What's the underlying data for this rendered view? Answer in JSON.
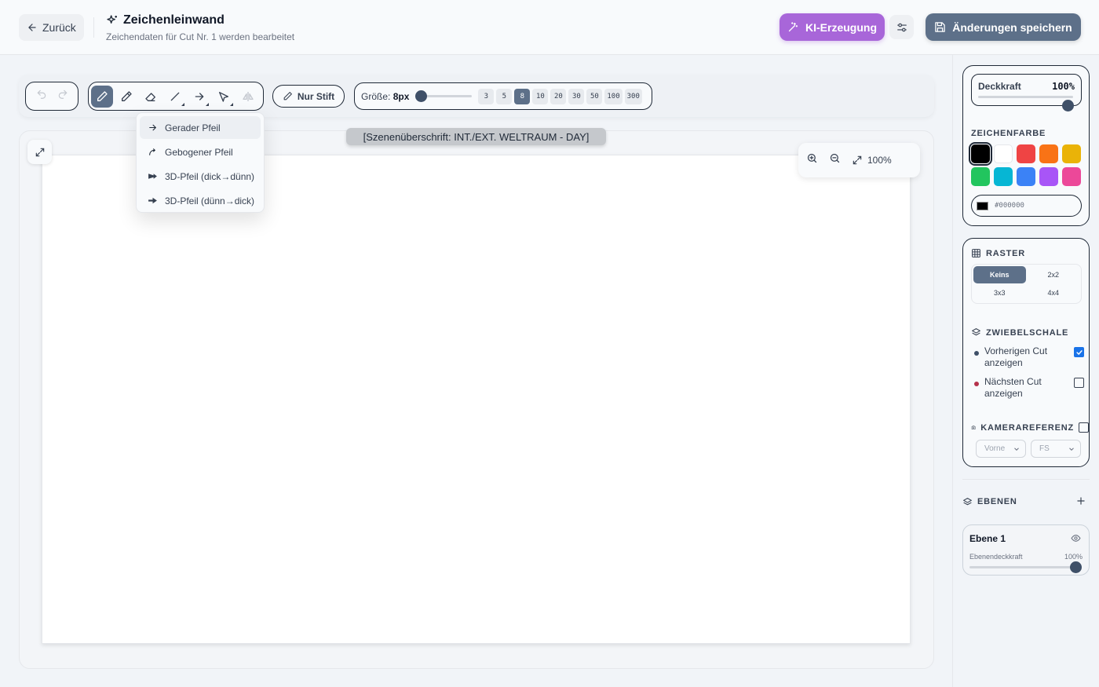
{
  "header": {
    "back_label": "Zurück",
    "title": "Zeichenleinwand",
    "subtitle": "Zeichendaten für Cut Nr. 1 werden bearbeitet",
    "ai_label": "KI-Erzeugung",
    "save_label": "Änderungen speichern"
  },
  "toolbar": {
    "pen_only_label": "Nur Stift",
    "size_label": "Größe:",
    "size_value": "8px",
    "size_presets": [
      "3",
      "5",
      "8",
      "10",
      "20",
      "30",
      "50",
      "100",
      "300"
    ],
    "active_preset": "8"
  },
  "arrow_menu": {
    "items": [
      {
        "label": "Gerader Pfeil",
        "icon": "arrow-right-icon"
      },
      {
        "label": "Gebogener Pfeil",
        "icon": "curved-arrow-icon"
      },
      {
        "label": "3D-Pfeil (dick→dünn)",
        "icon": "3d-arrow-thick-thin-icon"
      },
      {
        "label": "3D-Pfeil (dünn→dick)",
        "icon": "3d-arrow-thin-thick-icon"
      }
    ]
  },
  "canvas": {
    "scene_heading": "[Szenenüberschrift: INT./EXT. WELTRAUM - DAY]",
    "zoom": "100%"
  },
  "sidebar": {
    "opacity_label": "Deckkraft",
    "opacity_value": "100%",
    "color_title": "ZEICHENFARBE",
    "colors": [
      "#000000",
      "#ffffff",
      "#ef4444",
      "#f97316",
      "#eab308",
      "#22c55e",
      "#06b6d4",
      "#3b82f6",
      "#a855f7",
      "#ec4899"
    ],
    "selected_color": "#000000",
    "grid_title": "RASTER",
    "grid_options": [
      "Keins",
      "2x2",
      "3x3",
      "4x4"
    ],
    "grid_active": "Keins",
    "onion_title": "ZWIEBELSCHALE",
    "onion_prev": "Vorherigen Cut anzeigen",
    "onion_next": "Nächsten Cut anzeigen",
    "onion_prev_checked": true,
    "onion_next_checked": false,
    "camera_title": "KAMERAREFERENZ",
    "camera_checked": false,
    "camera_angle": "Vorne",
    "camera_shot": "FS",
    "layers_title": "EBENEN",
    "layer_name": "Ebene 1",
    "layer_opacity_label": "Ebenendeckkraft",
    "layer_opacity_value": "100%"
  }
}
